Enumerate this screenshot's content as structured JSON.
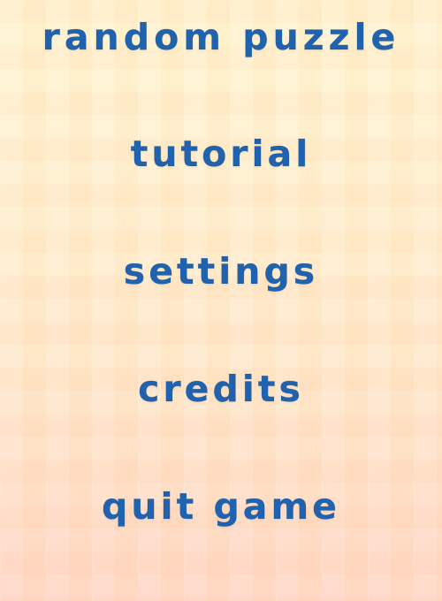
{
  "menu": {
    "items": [
      {
        "label": "random puzzle"
      },
      {
        "label": "tutorial"
      },
      {
        "label": "settings"
      },
      {
        "label": "credits"
      },
      {
        "label": "quit game"
      }
    ]
  },
  "colors": {
    "text": "#1f63b0",
    "background_top": "#fff2cf",
    "background_bottom": "#ffd3c2"
  }
}
